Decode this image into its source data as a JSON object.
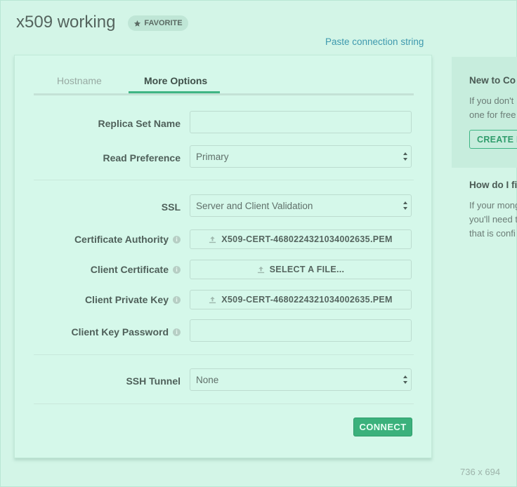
{
  "title": "x509 working",
  "favorite_label": "FAVORITE",
  "paste_link": "Paste connection string",
  "tabs": [
    {
      "label": "Hostname",
      "active": false
    },
    {
      "label": "More Options",
      "active": true
    }
  ],
  "form": {
    "replica_set_label": "Replica Set Name",
    "replica_set_value": "",
    "read_preference_label": "Read Preference",
    "read_preference_value": "Primary",
    "ssl_label": "SSL",
    "ssl_value": "Server and Client Validation",
    "cert_authority_label": "Certificate Authority",
    "cert_authority_file": "X509-CERT-4680224321034002635.PEM",
    "client_cert_label": "Client Certificate",
    "client_cert_file": "SELECT A FILE...",
    "client_key_label": "Client Private Key",
    "client_key_file": "X509-CERT-4680224321034002635.PEM",
    "client_key_password_label": "Client Key Password",
    "client_key_password_value": "",
    "ssh_tunnel_label": "SSH Tunnel",
    "ssh_tunnel_value": "None",
    "connect_label": "CONNECT"
  },
  "side_panel": {
    "heading1": "New to Co",
    "text1_line1": "If you don't",
    "text1_line2": "one for free",
    "create_label": "CREATE F",
    "heading2": "How do I fi",
    "text2_line1": "If your mong",
    "text2_line2": "you'll need t",
    "text2_line3": "that is confi"
  },
  "dims_label": "736 x 694",
  "colors": {
    "accent": "#3fb584",
    "link": "#3e99ae",
    "background": "#d3f5e7"
  }
}
